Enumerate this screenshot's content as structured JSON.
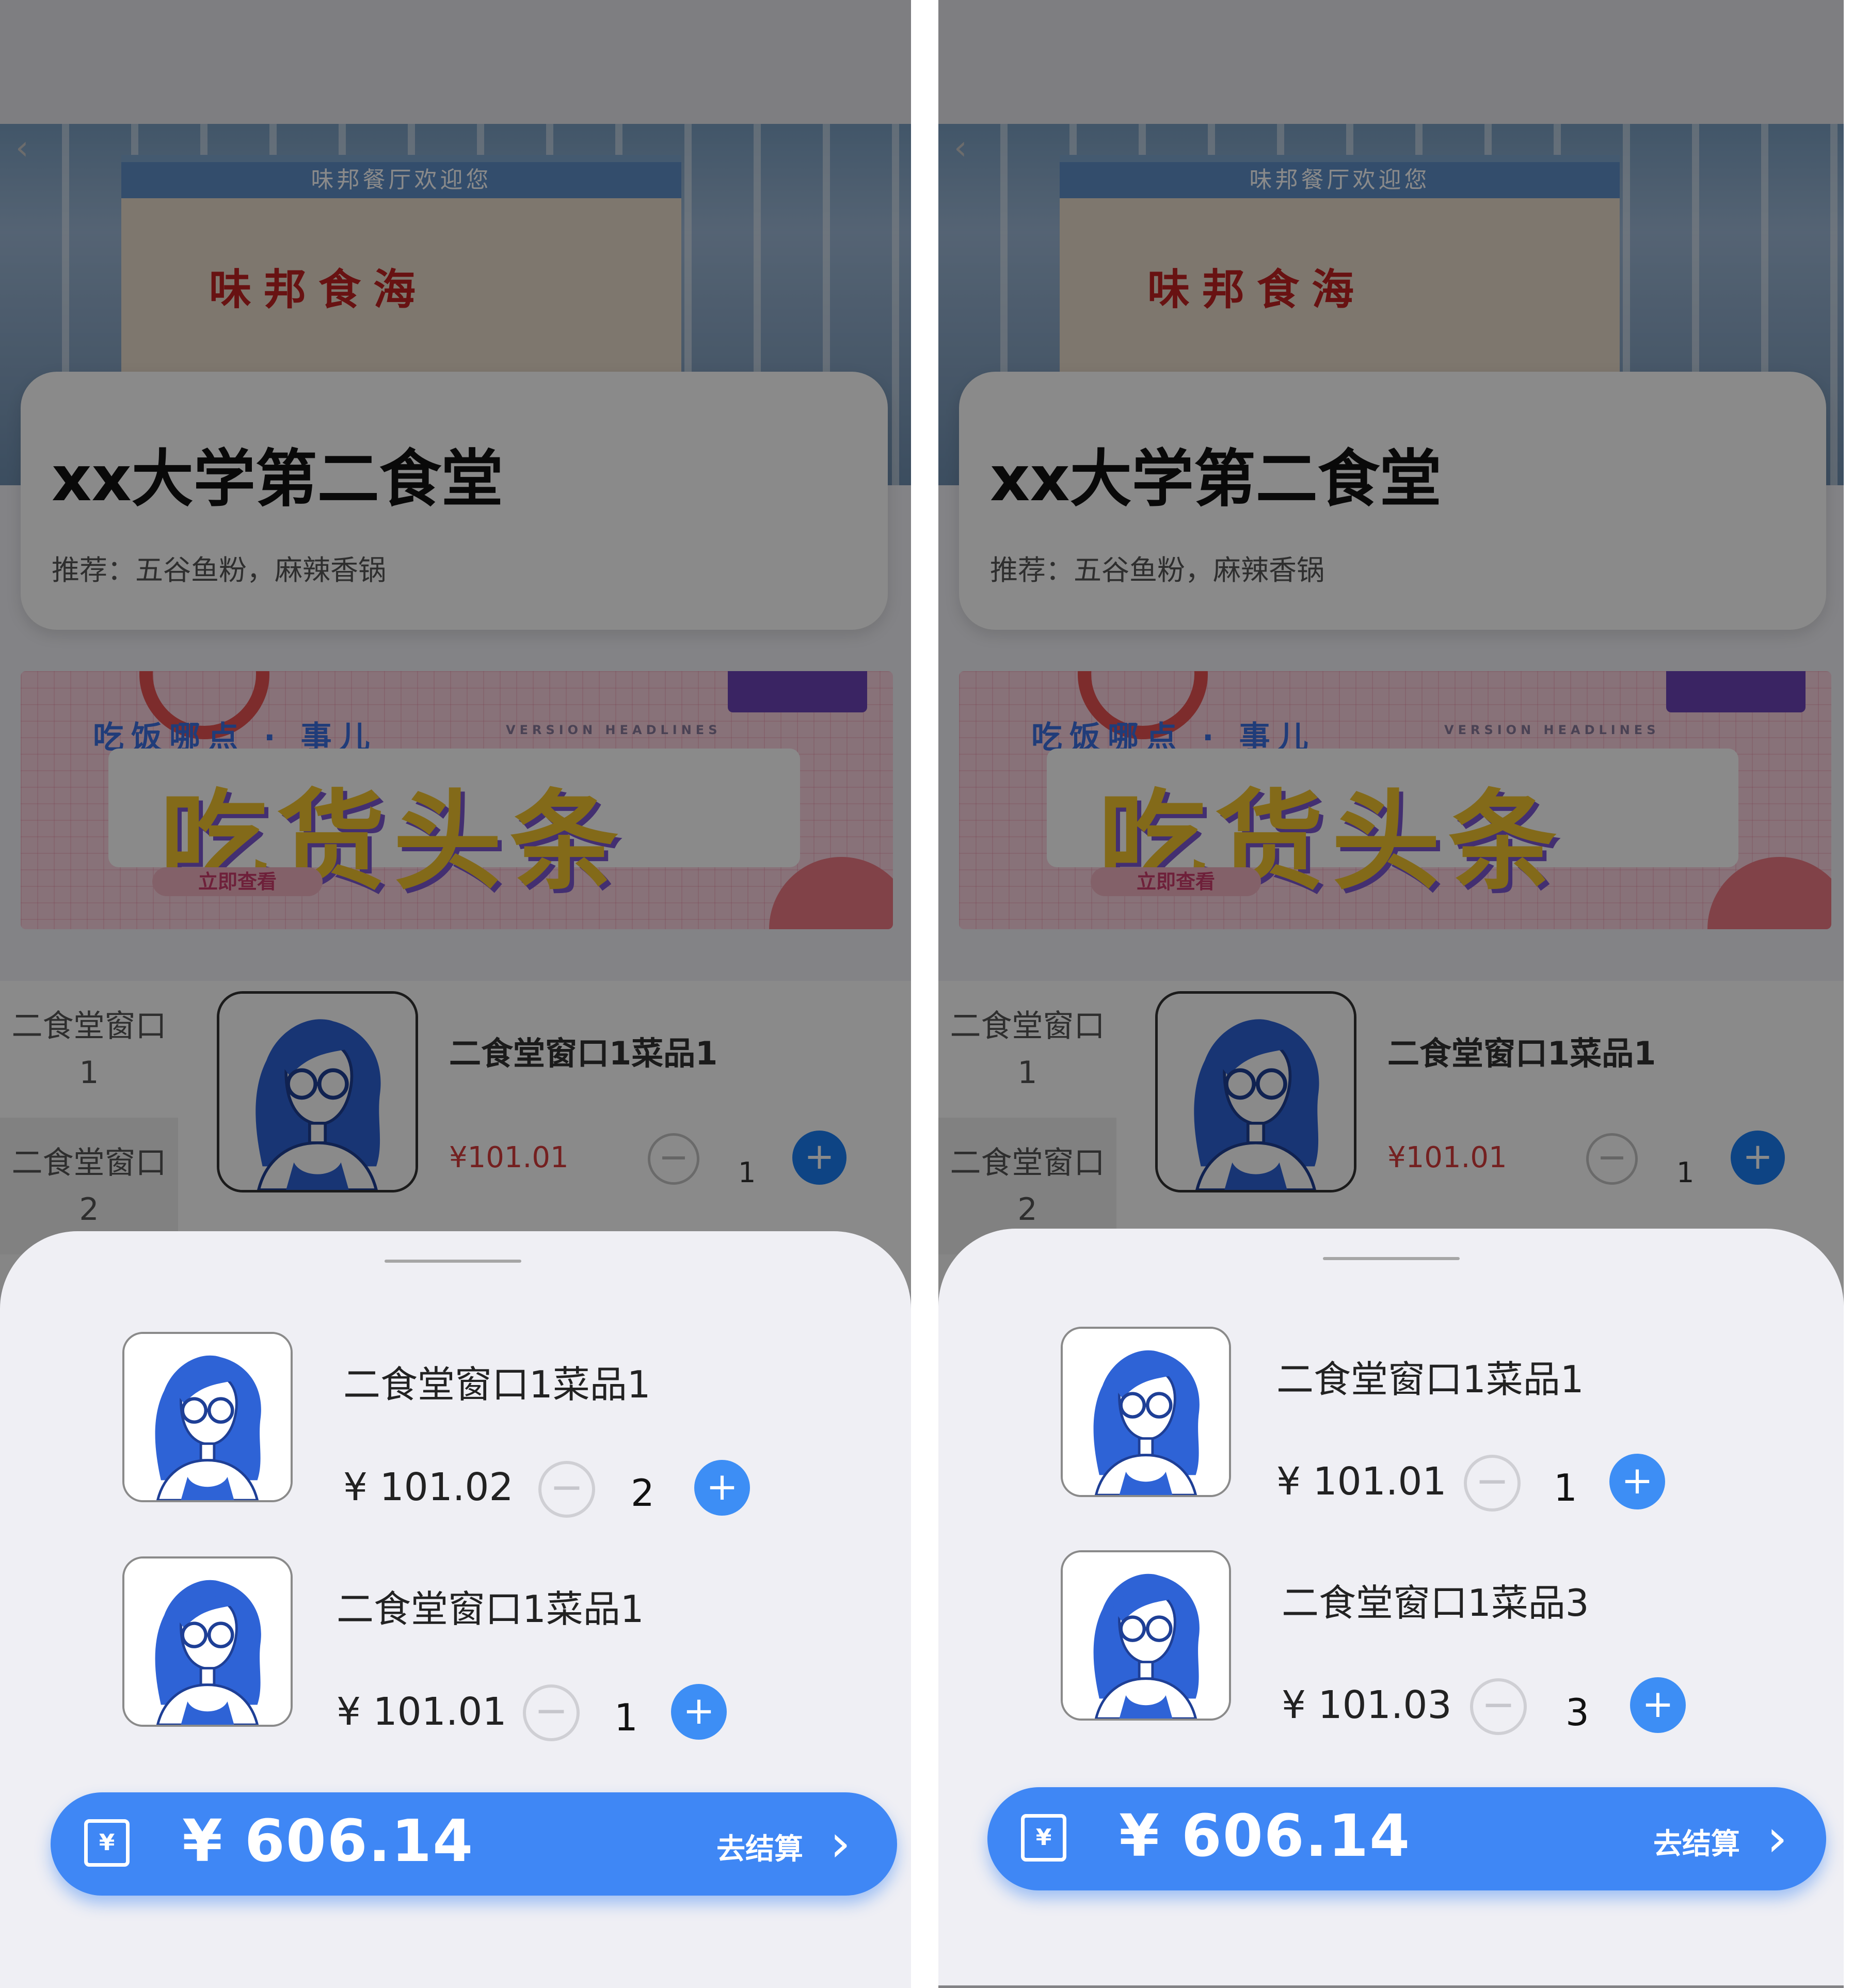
{
  "screens": [
    {
      "header": {
        "canteen_name": "xx大学第二食堂",
        "recommend": "推荐：五谷鱼粉，麻辣香锅"
      },
      "banner": {
        "tagline": "吃饭哪点 · 事儿",
        "tagline_en": "VERSION HEADLINES",
        "headline": "吃货头条",
        "cta": "立即查看"
      },
      "hero": {
        "top_sign": "味邦餐厅欢迎您",
        "main_sign": "味邦食海"
      },
      "menu": {
        "categories": [
          "二食堂窗口1",
          "二食堂窗口2"
        ],
        "dish": {
          "name": "二食堂窗口1菜品1",
          "price": "¥101.01",
          "qty": "1"
        }
      },
      "cart": {
        "items": [
          {
            "name": "二食堂窗口1菜品1",
            "price": "¥ 101.02",
            "qty": "2"
          },
          {
            "name": "二食堂窗口1菜品1",
            "price": "¥ 101.01",
            "qty": "1"
          }
        ],
        "total": "¥ 606.14",
        "checkout_label": "去结算"
      }
    },
    {
      "header": {
        "canteen_name": "xx大学第二食堂",
        "recommend": "推荐：五谷鱼粉，麻辣香锅"
      },
      "banner": {
        "tagline": "吃饭哪点 · 事儿",
        "tagline_en": "VERSION HEADLINES",
        "headline": "吃货头条",
        "cta": "立即查看"
      },
      "hero": {
        "top_sign": "味邦餐厅欢迎您",
        "main_sign": "味邦食海"
      },
      "menu": {
        "categories": [
          "二食堂窗口1",
          "二食堂窗口2"
        ],
        "dish": {
          "name": "二食堂窗口1菜品1",
          "price": "¥101.01",
          "qty": "1"
        }
      },
      "cart": {
        "items": [
          {
            "name": "二食堂窗口1菜品1",
            "price": "¥ 101.01",
            "qty": "1"
          },
          {
            "name": "二食堂窗口1菜品3",
            "price": "¥ 101.03",
            "qty": "3"
          }
        ],
        "total": "¥ 606.14",
        "checkout_label": "去结算"
      }
    }
  ],
  "icons": {
    "back": "chevron-left-icon",
    "minus": "minus-circle-icon",
    "plus": "plus-circle-icon",
    "wallet": "wallet-yen-icon",
    "arrow": "chevron-right-icon"
  },
  "colors": {
    "accent": "#3f87f5",
    "price_red": "#d63b3b",
    "sheet_bg": "#efeff4",
    "overlay": "rgba(0,0,0,0.46)"
  }
}
